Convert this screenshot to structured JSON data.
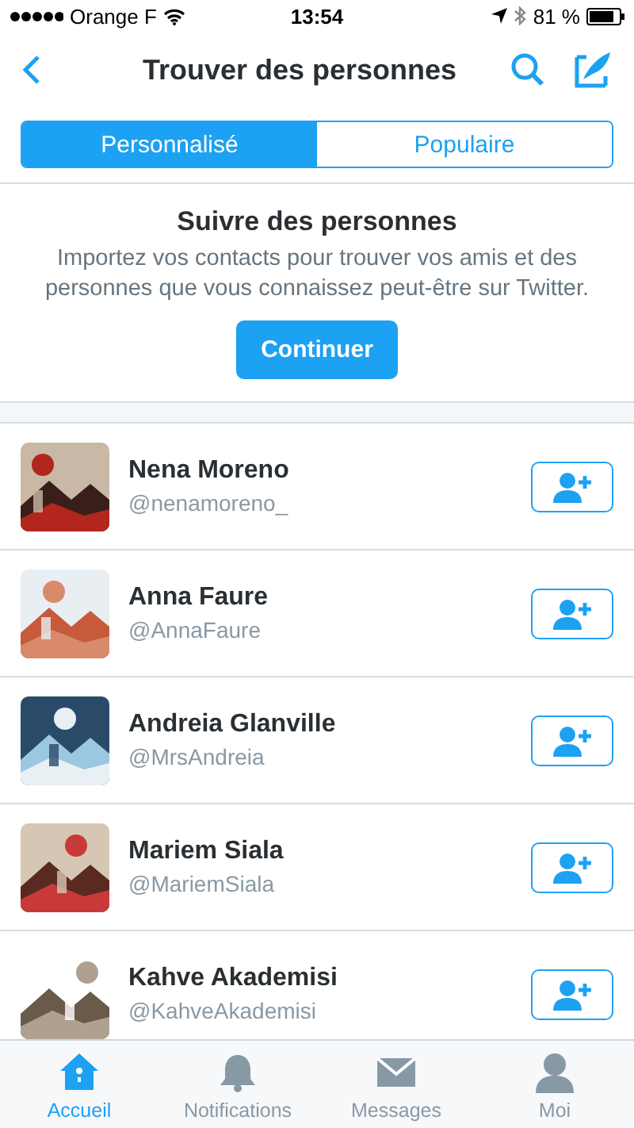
{
  "status_bar": {
    "carrier": "Orange F",
    "time": "13:54",
    "battery": "81 %"
  },
  "header": {
    "title": "Trouver des personnes"
  },
  "tabs": [
    {
      "label": "Personnalisé",
      "selected": true
    },
    {
      "label": "Populaire",
      "selected": false
    }
  ],
  "promo": {
    "title": "Suivre des personnes",
    "text": "Importez vos contacts pour trouver vos amis et des personnes que vous connaissez peut-être sur Twitter.",
    "button": "Continuer"
  },
  "people": [
    {
      "name": "Nena Moreno",
      "handle": "@nenamoreno_"
    },
    {
      "name": "Anna Faure",
      "handle": "@AnnaFaure"
    },
    {
      "name": "Andreia Glanville",
      "handle": "@MrsAndreia"
    },
    {
      "name": "Mariem Siala",
      "handle": "@MariemSiala"
    },
    {
      "name": "Kahve Akademisi",
      "handle": "@KahveAkademisi"
    }
  ],
  "tab_bar": [
    {
      "label": "Accueil",
      "kind": "home",
      "selected": true
    },
    {
      "label": "Notifications",
      "kind": "bell",
      "selected": false
    },
    {
      "label": "Messages",
      "kind": "mail",
      "selected": false
    },
    {
      "label": "Moi",
      "kind": "person",
      "selected": false
    }
  ]
}
